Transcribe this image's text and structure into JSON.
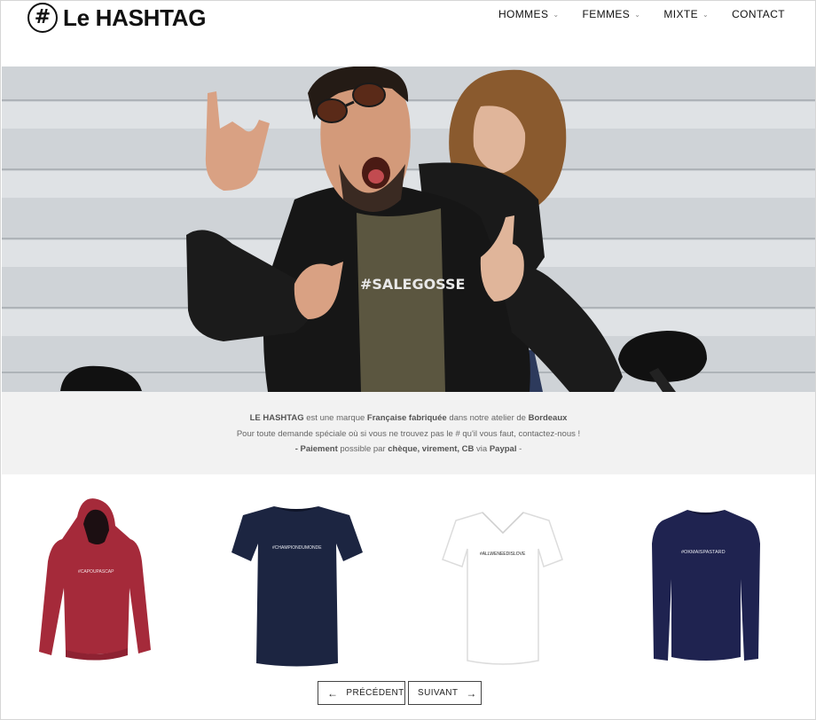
{
  "brand": {
    "logo_symbol": "#",
    "name": "Le HASHTAG"
  },
  "nav": {
    "items": [
      {
        "label": "HOMMES",
        "has_dropdown": true
      },
      {
        "label": "FEMMES",
        "has_dropdown": true
      },
      {
        "label": "MIXTE",
        "has_dropdown": true
      },
      {
        "label": "CONTACT",
        "has_dropdown": false
      }
    ]
  },
  "hero": {
    "tshirt_print": "#SALEGOSSE"
  },
  "intro": {
    "line1": {
      "brand": "LE HASHTAG",
      "t1": " est une marque ",
      "bold1": "Française fabriquée",
      "t2": " dans notre atelier de ",
      "bold2": "Bordeaux"
    },
    "line2": "Pour toute demande spéciale où si vous ne trouvez pas le # qu'il vous faut, contactez-nous !",
    "line3": {
      "bold1": "- Paiement",
      "t1": " possible par ",
      "bold2": "chèque, virement, CB",
      "t2": " via ",
      "bold3": "Paypal",
      "t3": " -"
    }
  },
  "products": [
    {
      "print": "#CAPOUPASCAP",
      "color": "#a52a3a",
      "type": "hoodie"
    },
    {
      "print": "#CHAMPIONDUMONDE",
      "color": "#1c2541",
      "type": "tshirt"
    },
    {
      "print": "#ALLWENEEDISLOVE",
      "color": "#ffffff",
      "type": "vneck"
    },
    {
      "print": "#OKMAISPASTARD",
      "color": "#1f2350",
      "type": "sweatshirt"
    }
  ],
  "pager": {
    "prev_label": "PRÉCÉDENT",
    "next_label": "SUIVANT",
    "prev_icon": "arrow-left-icon",
    "next_icon": "arrow-right-icon"
  }
}
